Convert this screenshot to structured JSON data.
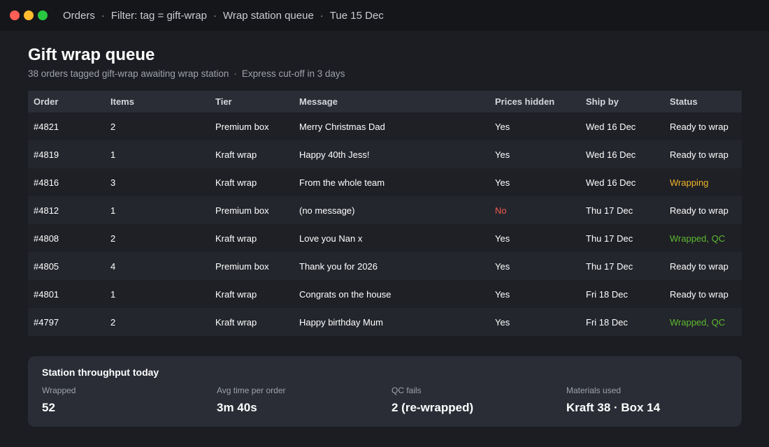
{
  "window": {
    "breadcrumbs": [
      "Orders",
      "Filter: tag = gift-wrap",
      "Wrap station queue",
      "Tue 15 Dec"
    ],
    "separator": "·"
  },
  "page": {
    "title": "Gift wrap queue",
    "subtitle_main": "38 orders tagged gift-wrap awaiting wrap station",
    "subtitle_sep": "·",
    "subtitle_extra": "Express cut-off in 3 days"
  },
  "table": {
    "columns": [
      "Order",
      "Items",
      "Tier",
      "Message",
      "Prices hidden",
      "Ship by",
      "Status"
    ],
    "rows": [
      {
        "order": "#4821",
        "items": "2",
        "tier": "Premium box",
        "message": "Merry Christmas Dad",
        "prices_hidden": "Yes",
        "ship_by": "Wed 16 Dec",
        "status": "Ready to wrap",
        "status_color": "#ffffff",
        "prices_color": "#ffffff"
      },
      {
        "order": "#4819",
        "items": "1",
        "tier": "Kraft wrap",
        "message": "Happy 40th Jess!",
        "prices_hidden": "Yes",
        "ship_by": "Wed 16 Dec",
        "status": "Ready to wrap",
        "status_color": "#ffffff",
        "prices_color": "#ffffff"
      },
      {
        "order": "#4816",
        "items": "3",
        "tier": "Kraft wrap",
        "message": "From the whole team",
        "prices_hidden": "Yes",
        "ship_by": "Wed 16 Dec",
        "status": "Wrapping",
        "status_color": "#f0b429",
        "prices_color": "#ffffff"
      },
      {
        "order": "#4812",
        "items": "1",
        "tier": "Premium box",
        "message": "(no message)",
        "prices_hidden": "No",
        "ship_by": "Thu 17 Dec",
        "status": "Ready to wrap",
        "status_color": "#ffffff",
        "prices_color": "#f05a4f"
      },
      {
        "order": "#4808",
        "items": "2",
        "tier": "Kraft wrap",
        "message": "Love you Nan x",
        "prices_hidden": "Yes",
        "ship_by": "Thu 17 Dec",
        "status": "Wrapped, QC",
        "status_color": "#5cb82e",
        "prices_color": "#ffffff"
      },
      {
        "order": "#4805",
        "items": "4",
        "tier": "Premium box",
        "message": "Thank you for 2026",
        "prices_hidden": "Yes",
        "ship_by": "Thu 17 Dec",
        "status": "Ready to wrap",
        "status_color": "#ffffff",
        "prices_color": "#ffffff"
      },
      {
        "order": "#4801",
        "items": "1",
        "tier": "Kraft wrap",
        "message": "Congrats on the house",
        "prices_hidden": "Yes",
        "ship_by": "Fri 18 Dec",
        "status": "Ready to wrap",
        "status_color": "#ffffff",
        "prices_color": "#ffffff"
      },
      {
        "order": "#4797",
        "items": "2",
        "tier": "Kraft wrap",
        "message": "Happy birthday Mum",
        "prices_hidden": "Yes",
        "ship_by": "Fri 18 Dec",
        "status": "Wrapped, QC",
        "status_color": "#5cb82e",
        "prices_color": "#ffffff"
      }
    ]
  },
  "throughput": {
    "title": "Station throughput today",
    "stats": [
      {
        "label": "Wrapped",
        "value": "52"
      },
      {
        "label": "Avg time per order",
        "value": "3m 40s"
      },
      {
        "label": "QC fails",
        "value": "2 (re-wrapped)"
      },
      {
        "label": "Materials used",
        "value": "Kraft 38 · Box 14"
      }
    ]
  },
  "colors": {
    "background": "#1c1d22",
    "titlebar": "#15161a",
    "header_row": "#2a2d36",
    "status_wrapping": "#f0b429",
    "status_wrapped": "#5cb82e",
    "prices_no": "#f05a4f"
  }
}
